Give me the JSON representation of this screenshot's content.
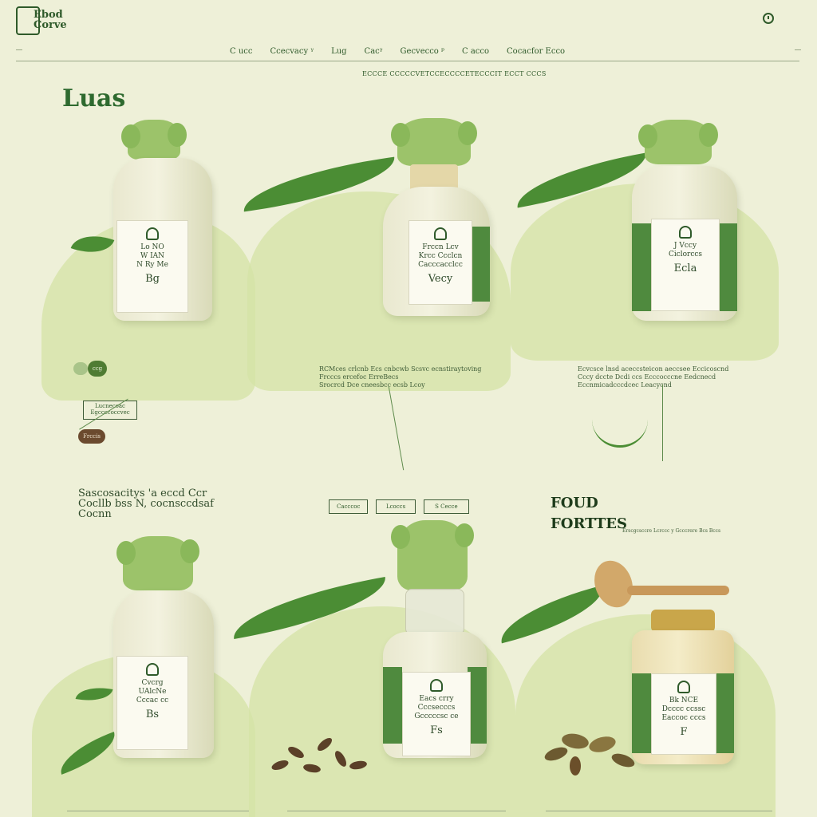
{
  "header": {
    "logo_text": "Ebod\nCorve",
    "nav_items": [
      "C ucc",
      "Ccecvacy ᵞ",
      "Lug",
      "Cacᵞ",
      "Gecvecco ᵖ",
      "C acco",
      "Cocacfor Ecco"
    ],
    "tagline": "ECCCE CCCCCVETCCECCCCETECCCIT ECCT CCCS",
    "title": "Luas"
  },
  "products_row1": [
    {
      "label_lines": [
        "Lo NO",
        "W IAN",
        "N Ry Me"
      ],
      "value": "Bg"
    },
    {
      "label_lines": [
        "Frccn Lcv",
        "Krcc Ccclcn",
        "Cacccacclcc"
      ],
      "value": "Vecy"
    },
    {
      "label_lines": [
        "J Vccy",
        "Ciclorccs"
      ],
      "value": "Ecla"
    }
  ],
  "row1_desc": {
    "badges": [
      "",
      "ccg"
    ],
    "mini_box": "Lucnecoac\nEgccccoccvec",
    "pill": "Frccis",
    "middle_text": "RCMces crlcnb Ecs cnbcwb Scsvc ecnstiraytoving\nFrcccs ercefoc ErreBecs\nSrocrcd Dce cneesbcc ecsb Lcoy",
    "right_text": "Ecvcsce lnsd aceccsteicon aeccsee Eccicoscnd\nCccy dccte Dcdi ccs Ecccocccne Eedcnecd\nEccnmicadcccdcec Leacycnd"
  },
  "row2_head": {
    "left": "Sascosacitys 'a eccd Ccr\nCocllb bss N, cocnsccdsaf\nCocnn",
    "tabs": [
      "Cacccoc",
      "Lcoccs",
      "S Cecce"
    ],
    "right_title": "FOUD\nFORTTES",
    "right_sub": "Erscgcsccre Lcrccc y Gcccrere Bcs Bccs"
  },
  "products_row2": [
    {
      "label_lines": [
        "Cvcrg",
        "UAlcNe",
        "Cccac cc"
      ],
      "value": "Bs"
    },
    {
      "label_lines": [
        "Eacs crry",
        "Cccsecccs",
        "Gcccccsc ce"
      ],
      "value": "Fs"
    },
    {
      "label_lines": [
        "Bk NCE",
        "Dcccc ccssc",
        "Eaccoc cccs"
      ],
      "value": "F"
    }
  ],
  "colors": {
    "accent": "#2f5a2a",
    "leaf": "#4b8d34",
    "blob": "#d4e3a6",
    "bg": "#eef0d8"
  }
}
